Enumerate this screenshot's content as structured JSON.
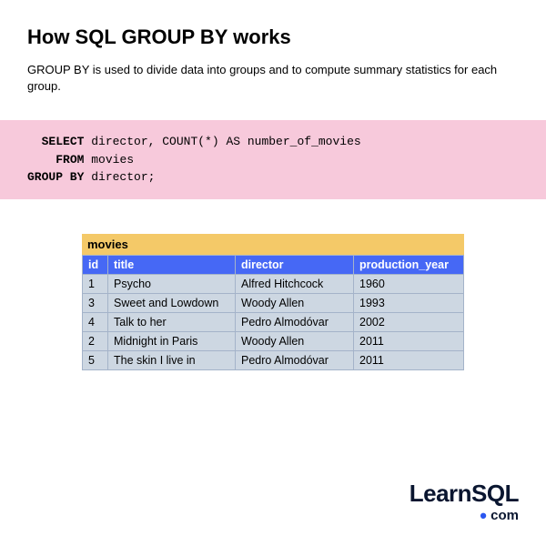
{
  "title": "How SQL GROUP BY works",
  "description": "GROUP BY is used to divide data into groups and to compute summary statistics for each group.",
  "code": {
    "select_kw": "SELECT",
    "select_rest": " director, COUNT(*) AS number_of_movies",
    "from_kw": "FROM",
    "from_rest": " movies",
    "group_kw": "GROUP BY",
    "group_rest": " director;"
  },
  "table": {
    "name": "movies",
    "headers": {
      "id": "id",
      "title": "title",
      "director": "director",
      "year": "production_year"
    },
    "rows": [
      {
        "id": "1",
        "title": "Psycho",
        "director": "Alfred Hitchcock",
        "year": "1960"
      },
      {
        "id": "3",
        "title": "Sweet and Lowdown",
        "director": "Woody Allen",
        "year": "1993"
      },
      {
        "id": "4",
        "title": "Talk to her",
        "director": "Pedro Almodóvar",
        "year": "2002"
      },
      {
        "id": "2",
        "title": "Midnight in Paris",
        "director": "Woody Allen",
        "year": "2011"
      },
      {
        "id": "5",
        "title": "The skin I live in",
        "director": "Pedro Almodóvar",
        "year": "2011"
      }
    ]
  },
  "logo": {
    "learn": "Learn",
    "sql": "SQL",
    "com": "com"
  }
}
